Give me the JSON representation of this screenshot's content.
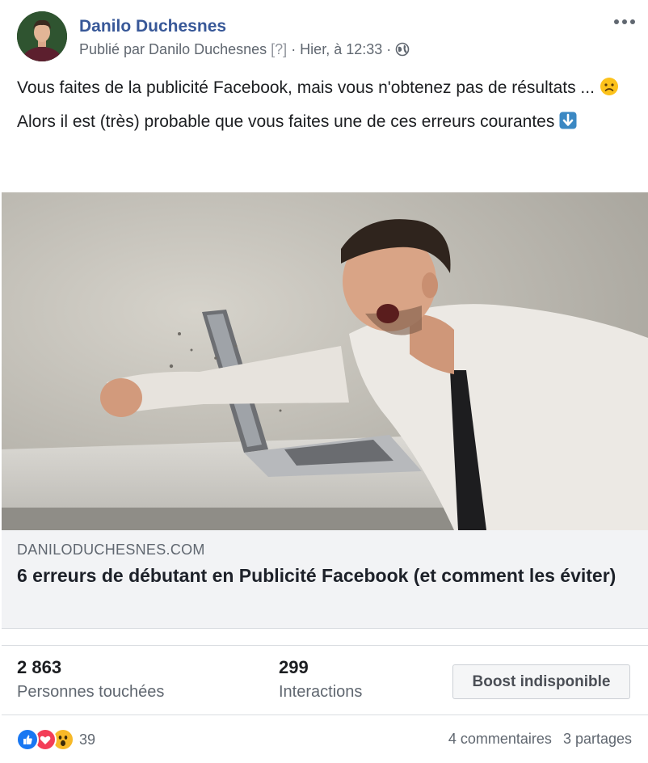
{
  "post": {
    "author": "Danilo Duchesnes",
    "meta_published": "Publié par Danilo Duchesnes",
    "meta_help": "[?]",
    "meta_time": "· Hier, à 12:33 ·",
    "message_line1": "Vous faites de la publicité Facebook, mais vous n'obtenez pas de résultats ...",
    "message_line2": "Alors il est (très) probable que vous faites une de ces erreurs courantes",
    "icons": {
      "more": "more-options-icon",
      "privacy": "globe-icon",
      "emoji1": "disappointed-face-emoji",
      "emoji2": "down-arrow-emoji"
    }
  },
  "link_preview": {
    "domain": "DANILODUCHESNES.COM",
    "title": "6 erreurs de débutant en Publicité Facebook (et comment les éviter)"
  },
  "insights": {
    "reach_value": "2 863",
    "reach_label": "Personnes touchées",
    "engagement_value": "299",
    "engagement_label": "Interactions",
    "boost_label": "Boost indisponible"
  },
  "footer": {
    "reaction_count": "39",
    "comments": "4 commentaires",
    "shares": "3 partages",
    "reaction_icons": [
      "like-icon",
      "love-icon",
      "wow-icon"
    ]
  },
  "colors": {
    "link_blue": "#385898",
    "secondary_text": "#606770",
    "like_blue": "#1877f2",
    "love_red": "#f33e58",
    "wow_yellow": "#f7b928"
  }
}
